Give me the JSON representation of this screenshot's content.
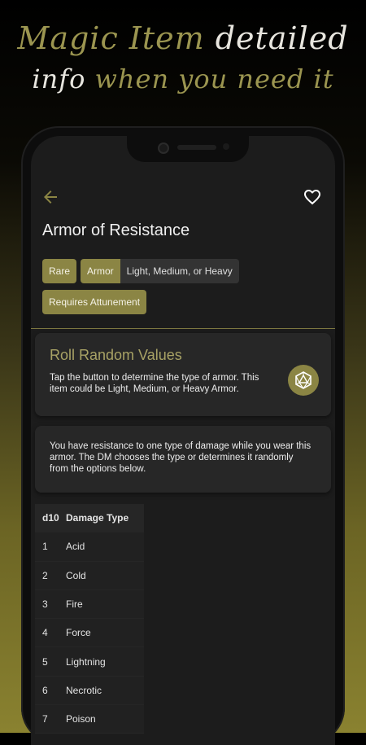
{
  "promo": {
    "line1_gold": "Magic Item",
    "line1_white": "detailed",
    "line2_white": "info",
    "line2_gold": "when you need it"
  },
  "item": {
    "title": "Armor of Resistance",
    "rarity": "Rare",
    "type_key": "Armor",
    "type_value": "Light, Medium, or Heavy",
    "attunement": "Requires Attunement"
  },
  "roll": {
    "heading": "Roll Random Values",
    "description": "Tap the button to determine the type of armor. This item could be Light, Medium, or Heavy Armor."
  },
  "description": "You have resistance to one type of damage while you wear this armor. The DM chooses the type or determines it randomly from the options below.",
  "table": {
    "headers": [
      "d10",
      "Damage Type"
    ],
    "rows": [
      [
        "1",
        "Acid"
      ],
      [
        "2",
        "Cold"
      ],
      [
        "3",
        "Fire"
      ],
      [
        "4",
        "Force"
      ],
      [
        "5",
        "Lightning"
      ],
      [
        "6",
        "Necrotic"
      ],
      [
        "7",
        "Poison"
      ]
    ]
  },
  "icons": {
    "back": "arrow-left-icon",
    "favorite": "heart-outline-icon",
    "roll": "d20-dice-icon"
  },
  "colors": {
    "accent": "#8b8544",
    "heading_gold": "#a8a265",
    "screen_bg": "#1c1c1c",
    "card_bg": "#272727"
  }
}
